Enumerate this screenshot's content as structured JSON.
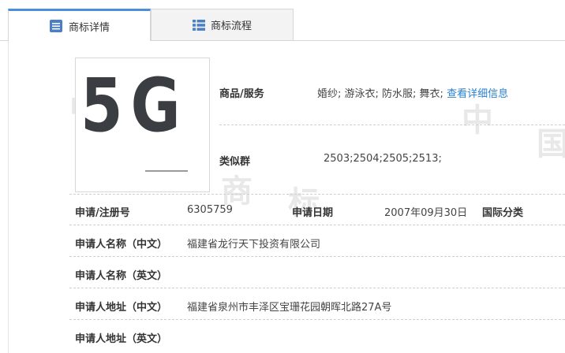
{
  "tabs": [
    {
      "label": "商标详情",
      "icon": "document-list-icon"
    },
    {
      "label": "商标流程",
      "icon": "grid-list-icon"
    }
  ],
  "trademark": {
    "image_text": "5G"
  },
  "goods_services": {
    "label": "商品/服务",
    "value": "婚纱; 游泳衣; 防水服; 舞衣;",
    "link": "查看详细信息"
  },
  "similar_group": {
    "label": "类似群",
    "value": "2503;2504;2505;2513;"
  },
  "registration": {
    "label": "申请/注册号",
    "value": "6305759"
  },
  "application_date": {
    "label": "申请日期",
    "value": "2007年09月30日"
  },
  "intl_class": {
    "label": "国际分类",
    "value": ""
  },
  "applicant_name_cn": {
    "label": "申请人名称（中文）",
    "value": "福建省龙行天下投资有限公司"
  },
  "applicant_name_en": {
    "label": "申请人名称（英文）",
    "value": ""
  },
  "applicant_addr_cn": {
    "label": "申请人地址（中文）",
    "value": "福建省泉州市丰泽区宝珊花园朝晖北路27A号"
  },
  "applicant_addr_en": {
    "label": "申请人地址（英文）",
    "value": ""
  },
  "colors": {
    "accent": "#4a90d9",
    "link": "#2a7fcf",
    "icon": "#4a7fc8"
  }
}
